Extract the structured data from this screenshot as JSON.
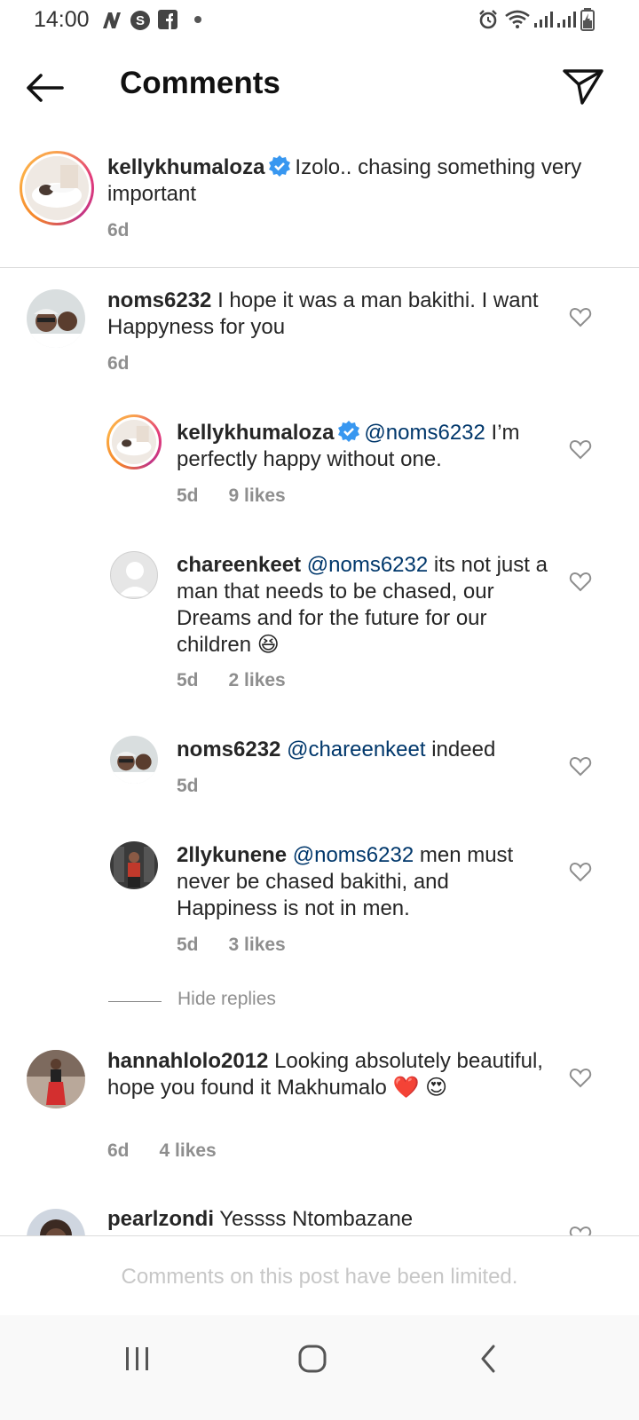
{
  "status_bar": {
    "time": "14:00"
  },
  "header": {
    "title": "Comments"
  },
  "caption": {
    "username": "kellykhumaloza",
    "text": "Izolo.. chasing something very important",
    "time": "6d"
  },
  "comments": [
    {
      "username": "noms6232",
      "text": "I hope it was a man bakithi. I want Happyness for you",
      "time": "6d"
    }
  ],
  "replies": [
    {
      "username": "kellykhumaloza",
      "mention": "@noms6232",
      "text": "I’m perfectly happy without one.",
      "time": "5d",
      "likes": "9 likes"
    },
    {
      "username": "chareenkeet",
      "mention": "@noms6232",
      "text": "its not just a man that needs to be chased, our Dreams and for the future for our children 😆",
      "time": "5d",
      "likes": "2 likes"
    },
    {
      "username": "noms6232",
      "mention": "@chareenkeet",
      "text": "indeed",
      "time": "5d"
    },
    {
      "username": "2llykunene",
      "mention": "@noms6232",
      "text": "men must never be chased bakithi,  and Happiness is not in men.",
      "time": "5d",
      "likes": "3 likes"
    }
  ],
  "hide_replies": "Hide replies",
  "comment3": {
    "username": "hannahlolo2012",
    "text": "Looking absolutely beautiful, hope you found it Makhumalo ❤️ 😍",
    "time": "6d",
    "likes": "4 likes"
  },
  "comment4": {
    "username": "pearlzondi",
    "text": "Yessss Ntombazane"
  },
  "footer": {
    "limited_text": "Comments on this post have been limited."
  },
  "colors": {
    "verified": "#3897f0",
    "mention": "#00376b",
    "meta": "#8e8e8e"
  },
  "icons": [
    "back-arrow-icon",
    "send-icon",
    "heart-outline-icon",
    "verified-badge-icon",
    "recent-apps-icon",
    "home-icon",
    "nav-back-icon"
  ]
}
